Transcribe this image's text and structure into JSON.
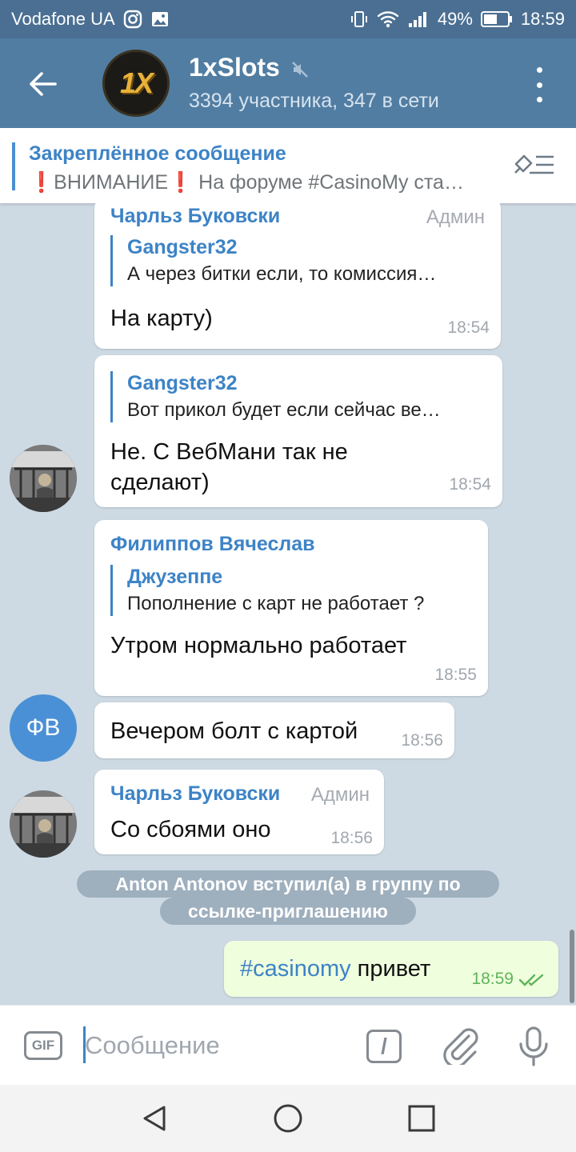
{
  "status_bar": {
    "carrier": "Vodafone UA",
    "battery": "49%",
    "time": "18:59"
  },
  "header": {
    "title": "1xSlots",
    "subtitle": "3394 участника, 347 в сети",
    "avatar_text": "1X"
  },
  "pinned": {
    "title": "Закреплённое сообщение",
    "text": "ВНИМАНИЕ",
    "text_rest": " На форуме #CasinoMy ста…"
  },
  "messages": [
    {
      "sender": "Чарльз Буковски",
      "badge": "Админ",
      "reply_name": "Gangster32",
      "reply_text": "А через битки если, то комиссия…",
      "text": "На карту)",
      "time": "18:54"
    },
    {
      "reply_name": "Gangster32",
      "reply_text": "Вот прикол будет если сейчас ве…",
      "text_line1": "Не. С ВебМани так не",
      "text_line2": "сделают)",
      "time": "18:54"
    },
    {
      "sender": "Филиппов Вячеслав",
      "reply_name": "Джузеппе",
      "reply_text": "Пополнение с карт не работает ?",
      "text": "Утром нормально работает",
      "time": "18:55"
    },
    {
      "text": "Вечером болт с картой",
      "time": "18:56",
      "avatar_initials": "ФВ"
    },
    {
      "sender": "Чарльз Буковски",
      "badge": "Админ",
      "text": "Со сбоями оно",
      "time": "18:56"
    }
  ],
  "service_message": {
    "line1": "Anton Antonov вступил(а) в группу по",
    "line2": "ссылке-приглашению"
  },
  "outgoing": {
    "hashtag": "#casinomy",
    "text": " привет",
    "time": "18:59"
  },
  "composer": {
    "gif_label": "GIF",
    "placeholder": "Сообщение",
    "command_label": "/"
  },
  "icons": {
    "back": "arrow-left-icon",
    "mute": "mute-icon",
    "more": "more-vert-icon",
    "pin": "pin-list-icon",
    "attach": "paperclip-icon",
    "mic": "microphone-icon",
    "read": "double-check-icon"
  },
  "colors": {
    "header": "#517da2",
    "status_bar": "#4a6f92",
    "accent": "#3d83c6",
    "outgoing_bubble": "#effedd",
    "chat_background": "#cdd9e3"
  }
}
